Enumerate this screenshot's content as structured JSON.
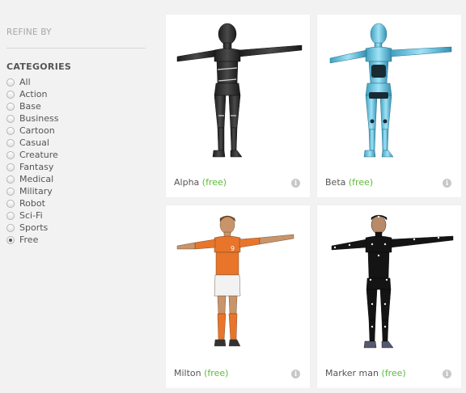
{
  "sidebar": {
    "refine_title": "REFINE BY",
    "categories_title": "CATEGORIES",
    "categories": [
      {
        "label": "All",
        "checked": false
      },
      {
        "label": "Action",
        "checked": false
      },
      {
        "label": "Base",
        "checked": false
      },
      {
        "label": "Business",
        "checked": false
      },
      {
        "label": "Cartoon",
        "checked": false
      },
      {
        "label": "Casual",
        "checked": false
      },
      {
        "label": "Creature",
        "checked": false
      },
      {
        "label": "Fantasy",
        "checked": false
      },
      {
        "label": "Medical",
        "checked": false
      },
      {
        "label": "Military",
        "checked": false
      },
      {
        "label": "Robot",
        "checked": false
      },
      {
        "label": "Sci-Fi",
        "checked": false
      },
      {
        "label": "Sports",
        "checked": false
      },
      {
        "label": "Free",
        "checked": true
      }
    ]
  },
  "models": [
    {
      "name": "Alpha",
      "price": "(free)"
    },
    {
      "name": "Beta",
      "price": "(free)"
    },
    {
      "name": "Milton",
      "price": "(free)"
    },
    {
      "name": "Marker man",
      "price": "(free)"
    }
  ],
  "info_glyph": "i",
  "colors": {
    "accent_free": "#5cbb3a",
    "background": "#f2f2f2"
  }
}
